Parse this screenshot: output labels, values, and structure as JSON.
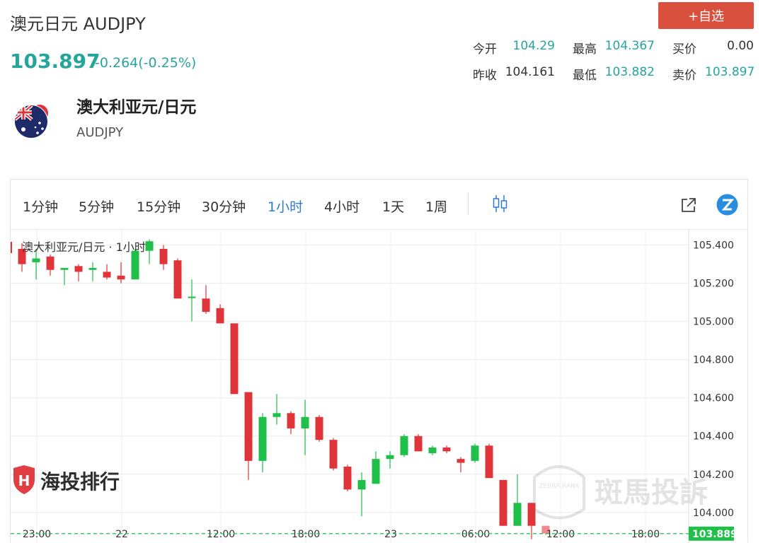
{
  "header": {
    "title": "澳元日元 AUDJPY",
    "price": "103.897",
    "change": "-0.264(-0.25%)",
    "add_button": "+自选"
  },
  "quote": {
    "open_label": "今开",
    "open": "104.29",
    "high_label": "最高",
    "high": "104.367",
    "bid_label": "买价",
    "bid": "0.00",
    "prev_label": "昨收",
    "prev": "104.161",
    "low_label": "最低",
    "low": "103.882",
    "ask_label": "卖价",
    "ask": "103.897"
  },
  "instrument": {
    "name": "澳大利亚元/日元",
    "code": "AUDJPY",
    "flag_icon": "australia-flag-icon"
  },
  "toolbar": {
    "timeframes": [
      "1分钟",
      "5分钟",
      "15分钟",
      "30分钟",
      "1小时",
      "4小时",
      "1天",
      "1周"
    ],
    "active": "1小时",
    "chart_type_icon": "candlestick-icon",
    "external_icon": "external-link-icon",
    "brand_icon": "zebra-logo-icon"
  },
  "chart_data": {
    "type": "candlestick",
    "legend": "澳大利亚元/日元 · 1小时",
    "up_color": "#1fbf4a",
    "down_color": "#e0343b",
    "ylim": [
      103.84,
      105.48
    ],
    "y_ticks": [
      "105.400",
      "105.200",
      "105.000",
      "104.800",
      "104.600",
      "104.400",
      "104.200",
      "104.000"
    ],
    "x_ticks": [
      "23:00",
      "22",
      "12:00",
      "18:00",
      "23",
      "06:00",
      "12:00",
      "18:00"
    ],
    "current_price": "103.889",
    "candles": [
      {
        "o": 105.38,
        "h": 105.41,
        "l": 105.26,
        "c": 105.3
      },
      {
        "o": 105.31,
        "h": 105.38,
        "l": 105.22,
        "c": 105.33
      },
      {
        "o": 105.34,
        "h": 105.35,
        "l": 105.24,
        "c": 105.27
      },
      {
        "o": 105.27,
        "h": 105.28,
        "l": 105.19,
        "c": 105.28
      },
      {
        "o": 105.29,
        "h": 105.3,
        "l": 105.21,
        "c": 105.26
      },
      {
        "o": 105.27,
        "h": 105.31,
        "l": 105.21,
        "c": 105.28
      },
      {
        "o": 105.26,
        "h": 105.3,
        "l": 105.22,
        "c": 105.23
      },
      {
        "o": 105.24,
        "h": 105.31,
        "l": 105.2,
        "c": 105.22
      },
      {
        "o": 105.22,
        "h": 105.38,
        "l": 105.22,
        "c": 105.37
      },
      {
        "o": 105.37,
        "h": 105.43,
        "l": 105.3,
        "c": 105.42
      },
      {
        "o": 105.38,
        "h": 105.4,
        "l": 105.27,
        "c": 105.3
      },
      {
        "o": 105.32,
        "h": 105.33,
        "l": 105.12,
        "c": 105.12
      },
      {
        "o": 105.13,
        "h": 105.22,
        "l": 105.0,
        "c": 105.13
      },
      {
        "o": 105.12,
        "h": 105.19,
        "l": 105.04,
        "c": 105.05
      },
      {
        "o": 105.07,
        "h": 105.09,
        "l": 104.99,
        "c": 104.99
      },
      {
        "o": 104.99,
        "h": 104.99,
        "l": 104.62,
        "c": 104.62
      },
      {
        "o": 104.63,
        "h": 104.63,
        "l": 104.17,
        "c": 104.27
      },
      {
        "o": 104.27,
        "h": 104.52,
        "l": 104.21,
        "c": 104.5
      },
      {
        "o": 104.5,
        "h": 104.62,
        "l": 104.46,
        "c": 104.52
      },
      {
        "o": 104.52,
        "h": 104.53,
        "l": 104.41,
        "c": 104.44
      },
      {
        "o": 104.44,
        "h": 104.59,
        "l": 104.3,
        "c": 104.5
      },
      {
        "o": 104.5,
        "h": 104.51,
        "l": 104.37,
        "c": 104.38
      },
      {
        "o": 104.38,
        "h": 104.39,
        "l": 104.22,
        "c": 104.23
      },
      {
        "o": 104.24,
        "h": 104.25,
        "l": 104.11,
        "c": 104.12
      },
      {
        "o": 104.12,
        "h": 104.21,
        "l": 103.98,
        "c": 104.17
      },
      {
        "o": 104.15,
        "h": 104.32,
        "l": 104.15,
        "c": 104.28
      },
      {
        "o": 104.28,
        "h": 104.32,
        "l": 104.23,
        "c": 104.3
      },
      {
        "o": 104.3,
        "h": 104.41,
        "l": 104.29,
        "c": 104.4
      },
      {
        "o": 104.4,
        "h": 104.41,
        "l": 104.32,
        "c": 104.32
      },
      {
        "o": 104.31,
        "h": 104.35,
        "l": 104.3,
        "c": 104.34
      },
      {
        "o": 104.34,
        "h": 104.35,
        "l": 104.31,
        "c": 104.32
      },
      {
        "o": 104.28,
        "h": 104.29,
        "l": 104.21,
        "c": 104.26
      },
      {
        "o": 104.27,
        "h": 104.36,
        "l": 104.26,
        "c": 104.35
      },
      {
        "o": 104.35,
        "h": 104.36,
        "l": 104.18,
        "c": 104.18
      },
      {
        "o": 104.17,
        "h": 104.17,
        "l": 103.93,
        "c": 103.93
      },
      {
        "o": 103.93,
        "h": 104.2,
        "l": 103.93,
        "c": 104.05
      },
      {
        "o": 104.05,
        "h": 104.05,
        "l": 103.86,
        "c": 103.93
      },
      {
        "o": 103.93,
        "h": 103.93,
        "l": 103.88,
        "c": 103.89
      }
    ]
  },
  "watermarks": {
    "left_brand": "海投排行",
    "right_brand": "斑馬投訴",
    "right_badge": "ZEBRA RANK"
  }
}
